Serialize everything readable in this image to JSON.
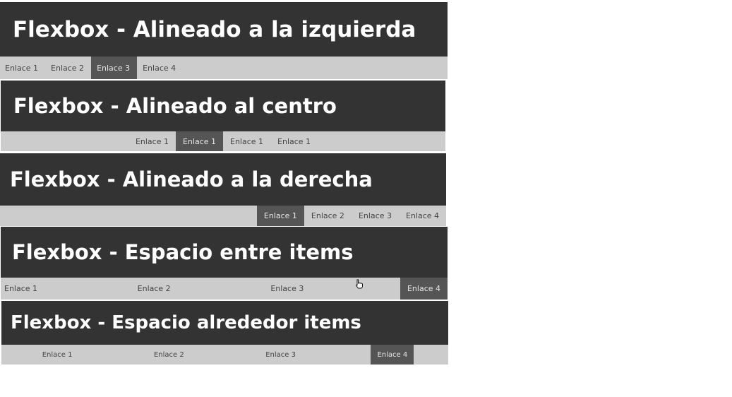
{
  "sections": [
    {
      "title": "Flexbox - Alineado a la izquierda",
      "links": [
        "Enlace 1",
        "Enlace 2",
        "Enlace 3",
        "Enlace 4"
      ],
      "active_index": 2
    },
    {
      "title": "Flexbox - Alineado al centro",
      "links": [
        "Enlace 1",
        "Enlace 1",
        "Enlace 1",
        "Enlace 1"
      ],
      "active_index": 1
    },
    {
      "title": "Flexbox - Alineado a la derecha",
      "links": [
        "Enlace 1",
        "Enlace 2",
        "Enlace 3",
        "Enlace 4"
      ],
      "active_index": 0
    },
    {
      "title": "Flexbox - Espacio entre items",
      "links": [
        "Enlace 1",
        "Enlace 2",
        "Enlace 3",
        "Enlace 4"
      ],
      "active_index": 3
    },
    {
      "title": "Flexbox - Espacio alrededor items",
      "links": [
        "Enlace 1",
        "Enlace 2",
        "Enlace 3",
        "Enlace 4"
      ],
      "active_index": 3
    }
  ],
  "colors": {
    "header_bg": "#333333",
    "header_text": "#ffffff",
    "nav_bg": "#cccccc",
    "active_bg": "#555555"
  },
  "cursor": "hand-pointer-icon"
}
